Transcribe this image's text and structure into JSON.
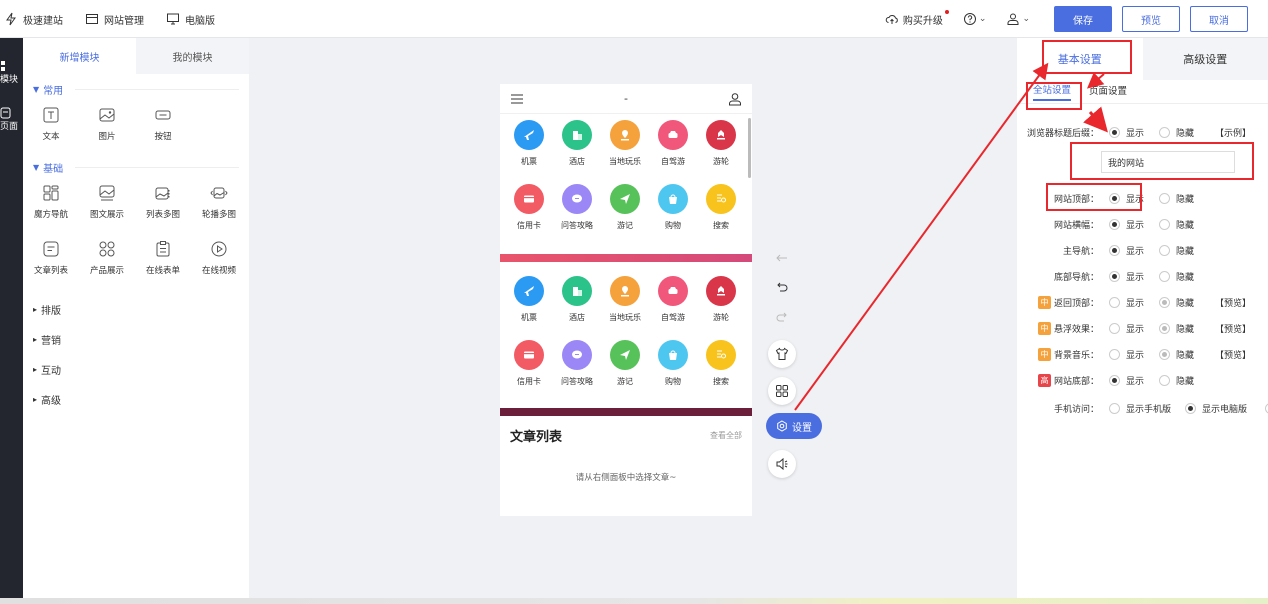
{
  "topbar": {
    "items": [
      {
        "label": "极速建站",
        "icon": "lightning-icon"
      },
      {
        "label": "网站管理",
        "icon": "window-icon"
      },
      {
        "label": "电脑版",
        "icon": "monitor-icon"
      }
    ],
    "buy_label": "购买升级",
    "save": "保存",
    "preview": "预览",
    "cancel": "取消"
  },
  "rail": {
    "module": "模块",
    "page": "页面"
  },
  "left_panel": {
    "tabs": [
      "新增模块",
      "我的模块"
    ],
    "sections": {
      "common": {
        "label": "常用",
        "items": [
          "文本",
          "图片",
          "按钮"
        ]
      },
      "basic": {
        "label": "基础",
        "items": [
          "魔方导航",
          "图文展示",
          "列表多图",
          "轮播多图",
          "文章列表",
          "产品展示",
          "在线表单",
          "在线视频"
        ]
      },
      "collapsed": [
        "排版",
        "营销",
        "互动",
        "高级"
      ]
    }
  },
  "phone": {
    "title": "-",
    "icons": [
      {
        "label": "机票",
        "color": "#2b9af3"
      },
      {
        "label": "酒店",
        "color": "#2cc38a"
      },
      {
        "label": "当地玩乐",
        "color": "#f5a13c"
      },
      {
        "label": "自驾游",
        "color": "#f1577a"
      },
      {
        "label": "游轮",
        "color": "#d9364a"
      },
      {
        "label": "信用卡",
        "color": "#f25b64"
      },
      {
        "label": "问答攻略",
        "color": "#9b87f5"
      },
      {
        "label": "游记",
        "color": "#58c25a"
      },
      {
        "label": "购物",
        "color": "#4ec7f0"
      },
      {
        "label": "搜索",
        "color": "#f7c31c"
      }
    ],
    "articles_title": "文章列表",
    "articles_more": "查看全部",
    "articles_empty": "请从右侧面板中选择文章~"
  },
  "tools": {
    "settings": "设置"
  },
  "right_panel": {
    "tabs": [
      "基本设置",
      "高级设置"
    ],
    "subtabs": [
      "全站设置",
      "页面设置"
    ],
    "show": "显示",
    "hide": "隐藏",
    "rows": {
      "browser_suffix": "浏览器标题后缀：",
      "example": "【示例】",
      "site_name": "我的网站",
      "site_top": "网站顶部：",
      "banner": "网站横幅：",
      "main_nav": "主导航：",
      "bottom_nav": "底部导航：",
      "back_top": "返回顶部：",
      "float": "悬浮效果：",
      "music": "背景音乐：",
      "site_bottom": "网站底部：",
      "preview": "【预览】",
      "mobile_access": "手机访问：",
      "show_mobile": "显示手机版",
      "show_pc": "显示电脑版"
    },
    "badges": {
      "mid": "中",
      "high": "高",
      "mid_color": "#f5a13c",
      "high_color": "#e8454a"
    }
  },
  "colors": {
    "primary": "#4a6ee0",
    "annotation": "#e8282d"
  }
}
